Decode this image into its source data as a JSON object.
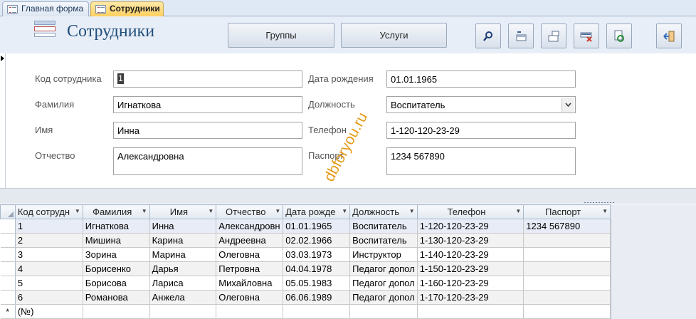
{
  "tabs": [
    {
      "label": "Главная форма",
      "active": false
    },
    {
      "label": "Сотрудники",
      "active": true
    }
  ],
  "header": {
    "title": "Сотрудники",
    "buttons": {
      "groups": "Группы",
      "services": "Услуги"
    },
    "icon_buttons": [
      "search-icon",
      "new-record-icon",
      "copy-record-icon",
      "delete-record-icon",
      "refresh-icon",
      "exit-icon"
    ]
  },
  "form": {
    "labels": {
      "id": "Код сотрудника",
      "last_name": "Фамилия",
      "first_name": "Имя",
      "patronymic": "Отчество",
      "birth_date": "Дата рождения",
      "position": "Должность",
      "phone": "Телефон",
      "passport": "Паспорт"
    },
    "values": {
      "id": "1",
      "last_name": "Игнаткова",
      "first_name": "Инна",
      "patronymic": "Александровна",
      "birth_date": "01.01.1965",
      "position": "Воспитатель",
      "phone": "1-120-120-23-29",
      "passport": "1234 567890"
    }
  },
  "watermark": "dbforyou.ru",
  "datasheet": {
    "columns": [
      "Код сотрудн",
      "Фамилия",
      "Имя",
      "Отчество",
      "Дата рожде",
      "Должность",
      "Телефон",
      "Паспорт"
    ],
    "rows": [
      [
        "1",
        "Игнаткова",
        "Инна",
        "Александровн",
        "01.01.1965",
        "Воспитатель",
        "1-120-120-23-29",
        "1234 567890"
      ],
      [
        "2",
        "Мишина",
        "Карина",
        "Андреевна",
        "02.02.1966",
        "Воспитатель",
        "1-130-120-23-29",
        ""
      ],
      [
        "3",
        "Зорина",
        "Марина",
        "Олеговна",
        "03.03.1973",
        "Инструктор",
        "1-140-120-23-29",
        ""
      ],
      [
        "4",
        "Борисенко",
        "Дарья",
        "Петровна",
        "04.04.1978",
        "Педагог допол",
        "1-150-120-23-29",
        ""
      ],
      [
        "5",
        "Борисова",
        "Лариса",
        "Михайловна",
        "05.05.1983",
        "Педагог допол",
        "1-160-120-23-29",
        ""
      ],
      [
        "6",
        "Романова",
        "Анжела",
        "Олеговна",
        "06.06.1989",
        "Педагог допол",
        "1-170-120-23-29",
        ""
      ]
    ],
    "new_row_marker": "*",
    "new_row_id": "(№)"
  }
}
